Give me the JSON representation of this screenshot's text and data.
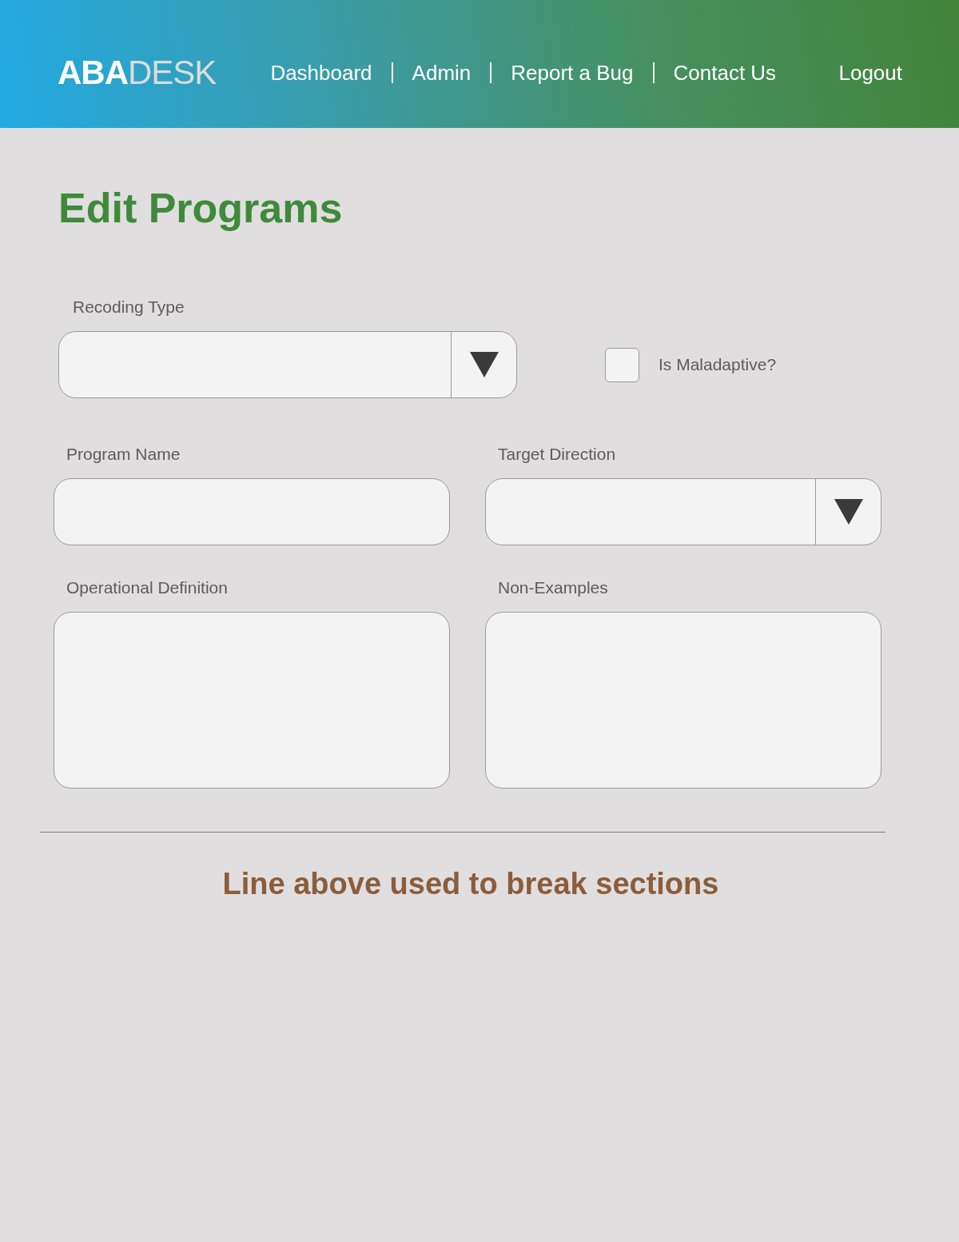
{
  "header": {
    "logo": "**ABA**DESK",
    "nav": [
      "Dashboard",
      "Admin",
      "Report a Bug",
      "Contact Us"
    ],
    "logout": "Logout"
  },
  "title": "Edit Programs",
  "form": {
    "rows": [
      [
        {
          "kind": "select",
          "label": "Recoding Type"
        },
        {
          "kind": "checkbox",
          "label": "Is Maladaptive?",
          "checked": false
        }
      ],
      [
        {
          "kind": "text",
          "label": "Program Name"
        },
        {
          "kind": "select",
          "label": "Target Direction"
        }
      ],
      [
        {
          "kind": "textarea",
          "label": "Operational Definition"
        },
        {
          "kind": "textarea",
          "label": "Non-Examples"
        }
      ]
    ]
  },
  "note": "Line above used to break sections"
}
